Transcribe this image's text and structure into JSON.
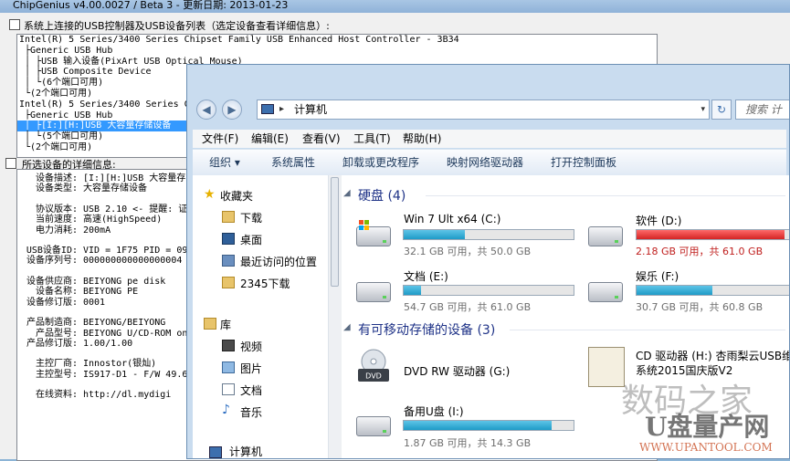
{
  "chipgenius": {
    "title": "ChipGenius v4.00.0027 / Beta 3 - 更新日期: 2013-01-23",
    "group1_label": "系统上连接的USB控制器及USB设备列表（选定设备查看详细信息）:",
    "tree": [
      "Intel(R) 5 Series/3400 Series Chipset Family USB Enhanced Host Controller - 3B34",
      " ├Generic USB Hub",
      " │ ├USB 输入设备(PixArt USB Optical Mouse)",
      " │ ├USB Composite Device",
      " │ └(6个端口可用)",
      " └(2个端口可用)",
      "Intel(R) 5 Series/3400 Series C",
      " ├Generic USB Hub",
      " │ ├[I:][H:]USB 大容量存储设备",
      " │ └(5个端口可用)",
      " └(2个端口可用)"
    ],
    "group2_label": "所选设备的详细信息:",
    "details": [
      {
        "k": "设备描述:",
        "v": "[I:][H:]USB 大容量存"
      },
      {
        "k": "设备类型:",
        "v": "大容量存储设备"
      },
      {
        "k": "协议版本:",
        "v": "USB 2.10 <- 提醒: 证"
      },
      {
        "k": "当前速度:",
        "v": "高速(HighSpeed)"
      },
      {
        "k": "电力消耗:",
        "v": "200mA"
      },
      {
        "k": "USB设备ID:",
        "v": "VID = 1F75 PID = 09"
      },
      {
        "k": "设备序列号:",
        "v": "000000000000000004"
      },
      {
        "k": "设备供应商:",
        "v": "BEIYONG pe disk"
      },
      {
        "k": "设备名称:",
        "v": "BEIYONG PE"
      },
      {
        "k": "设备修订版:",
        "v": "0001"
      },
      {
        "k": "产品制造商:",
        "v": "BEIYONG/BEIYONG"
      },
      {
        "k": "产品型号:",
        "v": "BEIYONG U/CD-ROM on"
      },
      {
        "k": "产品修订版:",
        "v": "1.00/1.00"
      },
      {
        "k": "主控厂商:",
        "v": "Innostor(银灿)"
      },
      {
        "k": "主控型号:",
        "v": "IS917-D1 - F/W 49.6"
      },
      {
        "k": "在线资料:",
        "v": "http://dl.mydigi"
      }
    ]
  },
  "explorer": {
    "address": "计算机",
    "search_placeholder": "搜索 计",
    "menu": [
      "文件(F)",
      "编辑(E)",
      "查看(V)",
      "工具(T)",
      "帮助(H)"
    ],
    "commands": [
      "组织 ▾",
      "系统属性",
      "卸载或更改程序",
      "映射网络驱动器",
      "打开控制面板"
    ],
    "nav": {
      "favorites": "收藏夹",
      "fav_items": [
        "下载",
        "桌面",
        "最近访问的位置",
        "2345下载"
      ],
      "libraries": "库",
      "lib_items": [
        "视频",
        "图片",
        "文档",
        "音乐"
      ],
      "computer": "计算机"
    },
    "sections": {
      "hdd": "硬盘 (4)",
      "removable": "有可移动存储的设备 (3)"
    },
    "drives": [
      {
        "name": "Win 7 Ult x64 (C:)",
        "info": "32.1 GB 可用，共 50.0 GB",
        "used": 0.358
      },
      {
        "name": "软件 (D:)",
        "info": "2.18 GB 可用，共 61.0 GB",
        "used": 0.964
      },
      {
        "name": "文档 (E:)",
        "info": "54.7 GB 可用，共 61.0 GB",
        "used": 0.103
      },
      {
        "name": "娱乐 (F:)",
        "info": "30.7 GB 可用，共 60.8 GB",
        "used": 0.495
      }
    ],
    "removable": [
      {
        "name": "DVD RW 驱动器 (G:)"
      },
      {
        "name": "CD 驱动器 (H:) 杏雨梨云USB维",
        "line2": "系统2015国庆版V2"
      },
      {
        "name": "备用U盘 (I:)",
        "info": "1.87 GB 可用，共 14.3 GB",
        "used": 0.869
      }
    ],
    "dvd_label": "DVD"
  },
  "watermark": {
    "line1": "数码之家",
    "line2": "U盘量产网",
    "line3": "WWW.UPANTOOL.COM"
  }
}
